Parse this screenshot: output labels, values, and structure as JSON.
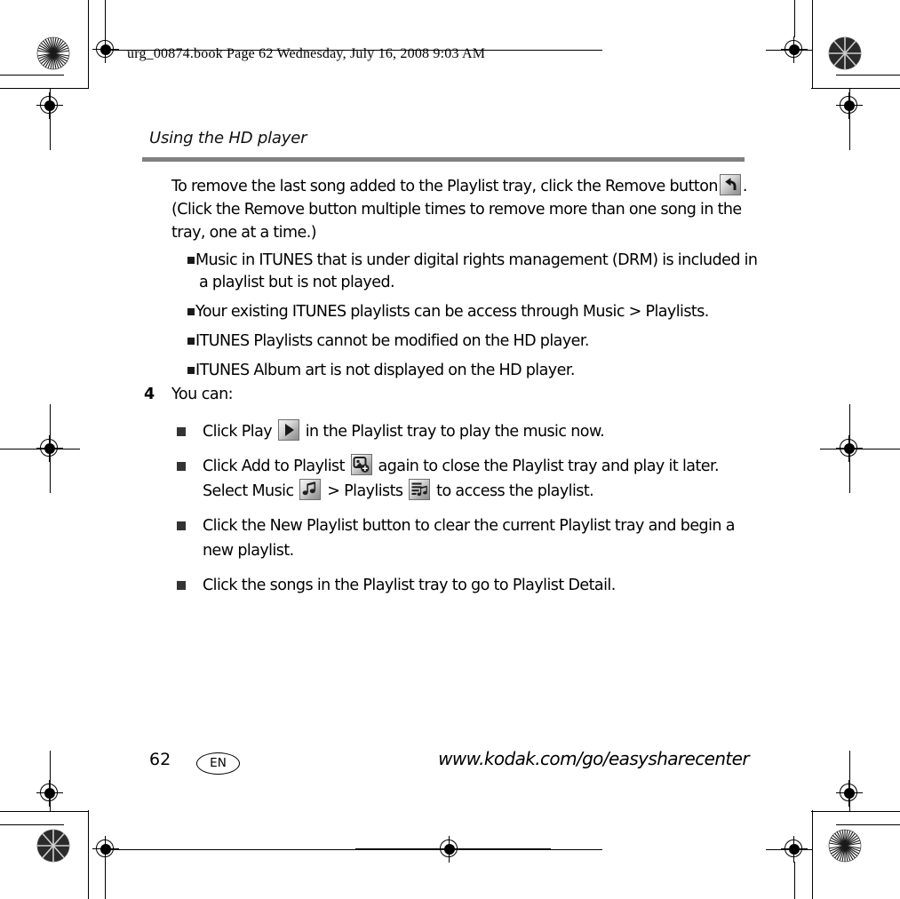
{
  "print_marks": {
    "doc_info": "urg_00874.book  Page 62  Wednesday, July 16, 2008  9:03 AM"
  },
  "running_head": {
    "title": "Using the HD player"
  },
  "body": {
    "intro_paragraph": "To remove the last song added to the Playlist tray, click the Remove button",
    "intro_paragraph_tail": ".",
    "intro_continued": "(Click the Remove button multiple times to remove more than one song in the tray, one at a time.)",
    "sub_bullets": [
      "Music in ITUNES that is under digital rights management (DRM) is included in a playlist but is not played.",
      "Your existing ITUNES playlists can be access through Music > Playlists.",
      "ITUNES Playlists cannot be modified on the HD player.",
      "ITUNES Album art is not displayed on the HD player."
    ],
    "step": {
      "number": "4",
      "text": "You can:"
    },
    "main_bullets": [
      {
        "before": "Click Play",
        "icon": "play-icon",
        "after": "in the Playlist tray to play the music now."
      },
      {
        "before": "Click Add to Playlist",
        "icon": "add-to-playlist-icon",
        "mid": "again to close the Playlist tray and play it later. Select Music",
        "icon2": "music-note-icon",
        "mid2": "> Playlists",
        "icon3": "playlists-icon",
        "after": "to access the playlist."
      },
      {
        "before": "Click the New Playlist button to clear the current Playlist tray and begin a new playlist.",
        "icon": "",
        "after": ""
      },
      {
        "before": "Click the songs in the Playlist tray to go to Playlist Detail.",
        "icon": "",
        "after": ""
      }
    ]
  },
  "footer": {
    "page_number": "62",
    "language_code": "EN",
    "url": "www.kodak.com/go/easysharecenter"
  },
  "colors": {
    "rule": "#808080",
    "bullet": "#333333",
    "text": "#000000"
  }
}
